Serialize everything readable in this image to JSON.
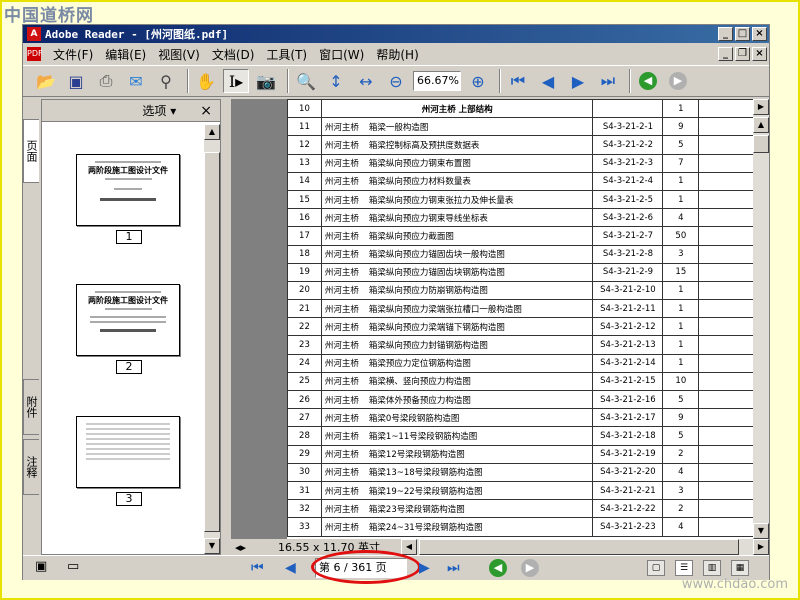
{
  "watermark": {
    "site_cn": "中国道桥网",
    "site_url": "www.chdao.com"
  },
  "window": {
    "title": "Adobe Reader - [州河图纸.pdf]",
    "app_icon": "pdf-icon"
  },
  "menu": [
    "文件(F)",
    "编辑(E)",
    "视图(V)",
    "文档(D)",
    "工具(T)",
    "窗口(W)",
    "帮助(H)"
  ],
  "toolbar": {
    "zoom_value": "66.67%",
    "icons": [
      "open-folder-icon",
      "save-disk-icon",
      "print-icon",
      "email-icon",
      "search-binoculars-icon",
      "hand-tool-icon",
      "select-text-icon",
      "snapshot-camera-icon",
      "zoom-in-icon",
      "fit-page-icon",
      "fit-width-icon",
      "zoom-out-icon",
      "zoom-plus-icon",
      "first-page-icon",
      "prev-page-icon",
      "next-page-icon",
      "last-page-icon",
      "back-icon",
      "forward-icon"
    ]
  },
  "sidebar": {
    "options_label": "选项",
    "close_glyph": "×",
    "tabs": [
      "页面",
      "附件",
      "注释"
    ],
    "thumbnails": [
      {
        "label": "1",
        "title": "两阶段施工图设计文件"
      },
      {
        "label": "2",
        "title": "两阶段施工图设计文件"
      },
      {
        "label": "3",
        "title": ""
      }
    ]
  },
  "document": {
    "header_row": {
      "no": "10",
      "name": "州河主桥  上部结构",
      "code": "",
      "count": "1"
    },
    "rows": [
      {
        "no": "11",
        "bridge": "州河主桥",
        "name": "箱梁一般构造图",
        "code": "S4-3-21-2-1",
        "count": "9"
      },
      {
        "no": "12",
        "bridge": "州河主桥",
        "name": "箱梁控制标高及预拱度数据表",
        "code": "S4-3-21-2-2",
        "count": "5"
      },
      {
        "no": "13",
        "bridge": "州河主桥",
        "name": "箱梁纵向预应力钢束布置图",
        "code": "S4-3-21-2-3",
        "count": "7"
      },
      {
        "no": "14",
        "bridge": "州河主桥",
        "name": "箱梁纵向预应力材料数量表",
        "code": "S4-3-21-2-4",
        "count": "1"
      },
      {
        "no": "15",
        "bridge": "州河主桥",
        "name": "箱梁纵向预应力钢束张拉力及伸长量表",
        "code": "S4-3-21-2-5",
        "count": "1"
      },
      {
        "no": "16",
        "bridge": "州河主桥",
        "name": "箱梁纵向预应力钢束导线坐标表",
        "code": "S4-3-21-2-6",
        "count": "4"
      },
      {
        "no": "17",
        "bridge": "州河主桥",
        "name": "箱梁纵向预应力截面图",
        "code": "S4-3-21-2-7",
        "count": "50"
      },
      {
        "no": "18",
        "bridge": "州河主桥",
        "name": "箱梁纵向预应力锚固齿块一般构造图",
        "code": "S4-3-21-2-8",
        "count": "3"
      },
      {
        "no": "19",
        "bridge": "州河主桥",
        "name": "箱梁纵向预应力锚固齿块钢筋构造图",
        "code": "S4-3-21-2-9",
        "count": "15"
      },
      {
        "no": "20",
        "bridge": "州河主桥",
        "name": "箱梁纵向预应力防崩钢筋构造图",
        "code": "S4-3-21-2-10",
        "count": "1"
      },
      {
        "no": "21",
        "bridge": "州河主桥",
        "name": "箱梁纵向预应力梁端张拉槽口一般构造图",
        "code": "S4-3-21-2-11",
        "count": "1"
      },
      {
        "no": "22",
        "bridge": "州河主桥",
        "name": "箱梁纵向预应力梁端锚下钢筋构造图",
        "code": "S4-3-21-2-12",
        "count": "1"
      },
      {
        "no": "23",
        "bridge": "州河主桥",
        "name": "箱梁纵向预应力封锚钢筋构造图",
        "code": "S4-3-21-2-13",
        "count": "1"
      },
      {
        "no": "24",
        "bridge": "州河主桥",
        "name": "箱梁预应力定位钢筋构造图",
        "code": "S4-3-21-2-14",
        "count": "1"
      },
      {
        "no": "25",
        "bridge": "州河主桥",
        "name": "箱梁横、竖向预应力构造图",
        "code": "S4-3-21-2-15",
        "count": "10"
      },
      {
        "no": "26",
        "bridge": "州河主桥",
        "name": "箱梁体外预备预应力构造图",
        "code": "S4-3-21-2-16",
        "count": "5"
      },
      {
        "no": "27",
        "bridge": "州河主桥",
        "name": "箱梁0号梁段钢筋构造图",
        "code": "S4-3-21-2-17",
        "count": "9"
      },
      {
        "no": "28",
        "bridge": "州河主桥",
        "name": "箱梁1~11号梁段钢筋构造图",
        "code": "S4-3-21-2-18",
        "count": "5"
      },
      {
        "no": "29",
        "bridge": "州河主桥",
        "name": "箱梁12号梁段钢筋构造图",
        "code": "S4-3-21-2-19",
        "count": "2"
      },
      {
        "no": "30",
        "bridge": "州河主桥",
        "name": "箱梁13~18号梁段钢筋构造图",
        "code": "S4-3-21-2-20",
        "count": "4"
      },
      {
        "no": "31",
        "bridge": "州河主桥",
        "name": "箱梁19~22号梁段钢筋构造图",
        "code": "S4-3-21-2-21",
        "count": "3"
      },
      {
        "no": "32",
        "bridge": "州河主桥",
        "name": "箱梁23号梁段钢筋构造图",
        "code": "S4-3-21-2-22",
        "count": "2"
      },
      {
        "no": "33",
        "bridge": "州河主桥",
        "name": "箱梁24~31号梁段钢筋构造图",
        "code": "S4-3-21-2-23",
        "count": "4"
      }
    ],
    "page_size": "16.55 x 11.70 英寸"
  },
  "statusbar": {
    "page_info": "第 6 / 361 页",
    "highlight_color": "#e01010"
  }
}
